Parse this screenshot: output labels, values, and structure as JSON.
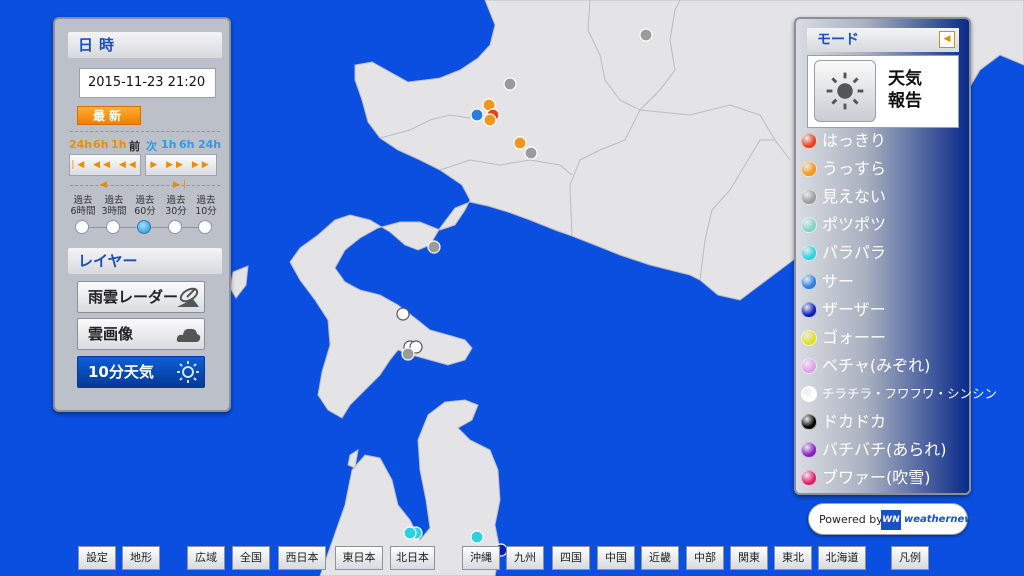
{
  "colors": {
    "sea": "#0a4fe0",
    "land": "#e4e4e6",
    "accent": "#1d4fb8"
  },
  "datetime_panel": {
    "title": "日時",
    "datetime": "2015-11-23 21:20",
    "latest_label": "最新",
    "prev_steps": [
      "24h",
      "6h",
      "1h"
    ],
    "prev_label": "前",
    "next_label": "次",
    "next_steps": [
      "1h",
      "6h",
      "24h"
    ],
    "past_options": [
      {
        "line1": "過去",
        "line2": "6時間"
      },
      {
        "line1": "過去",
        "line2": "3時間"
      },
      {
        "line1": "過去",
        "line2": "60分"
      },
      {
        "line1": "過去",
        "line2": "30分"
      },
      {
        "line1": "過去",
        "line2": "10分"
      }
    ],
    "selected_past_index": 2
  },
  "layer_panel": {
    "title": "レイヤー",
    "buttons": [
      {
        "label": "雨雲レーダー",
        "icon": "radar-icon",
        "active": false
      },
      {
        "label": "雲画像",
        "icon": "cloud-icon",
        "active": false
      },
      {
        "label": "10分天気",
        "icon": "sun-icon",
        "active": true
      }
    ]
  },
  "mode_panel": {
    "title": "モード",
    "mode_label_line1": "天気",
    "mode_label_line2": "報告",
    "mode_icon": "sun-icon"
  },
  "legend": [
    {
      "label": "はっきり",
      "color": "#e8411e"
    },
    {
      "label": "うっすら",
      "color": "#f2971b"
    },
    {
      "label": "見えない",
      "color": "#9b9b9b"
    },
    {
      "label": "ポツポツ",
      "color": "#7fd6c0"
    },
    {
      "label": "パラパラ",
      "color": "#2ed0e0"
    },
    {
      "label": "サー",
      "color": "#2a7ee0"
    },
    {
      "label": "ザーザー",
      "color": "#0b1fb8"
    },
    {
      "label": "ゴォーー",
      "color": "#e3e02a"
    },
    {
      "label": "ベチャ(みぞれ)",
      "color": "#e0a0e8"
    },
    {
      "label": "チラチラ・フワフワ・シンシン",
      "color": "#ffffff"
    },
    {
      "label": "ドカドカ",
      "color": "#000000"
    },
    {
      "label": "バチバチ(あられ)",
      "color": "#8a1fc0"
    },
    {
      "label": "ブワァー(吹雪)",
      "color": "#e0206a"
    }
  ],
  "powered_by": {
    "text": "Powered by",
    "logo": "WN",
    "brand": "weathernews"
  },
  "bottom_bar": [
    "設定",
    "地形",
    "広域",
    "全国",
    "西日本",
    "東日本",
    "北日本",
    "沖縄",
    "九州",
    "四国",
    "中国",
    "近畿",
    "中部",
    "関東",
    "東北",
    "北海道",
    "凡例"
  ],
  "map_reports": [
    {
      "type": "見えない",
      "color": "#9b9b9b"
    },
    {
      "type": "見えない",
      "color": "#9b9b9b"
    },
    {
      "type": "うっすら",
      "color": "#f2971b"
    },
    {
      "type": "はっきり",
      "color": "#e8411e"
    },
    {
      "type": "サー",
      "color": "#2a7ee0"
    },
    {
      "type": "うっすら",
      "color": "#f2971b"
    },
    {
      "type": "うっすら",
      "color": "#f2971b"
    },
    {
      "type": "見えない",
      "color": "#9b9b9b"
    },
    {
      "type": "見えない",
      "color": "#9b9b9b"
    },
    {
      "type": "チラチラ・フワフワ・シンシン",
      "color": "#ffffff"
    },
    {
      "type": "チラチラ・フワフワ・シンシン",
      "color": "#ffffff"
    },
    {
      "type": "チラチラ・フワフワ・シンシン",
      "color": "#ffffff"
    },
    {
      "type": "見えない",
      "color": "#9b9b9b"
    },
    {
      "type": "パラパラ",
      "color": "#2ed0e0"
    },
    {
      "type": "パラパラ",
      "color": "#2ed0e0"
    },
    {
      "type": "パラパラ",
      "color": "#2ed0e0"
    },
    {
      "type": "ザーザー",
      "color": "#0b1fb8"
    }
  ]
}
